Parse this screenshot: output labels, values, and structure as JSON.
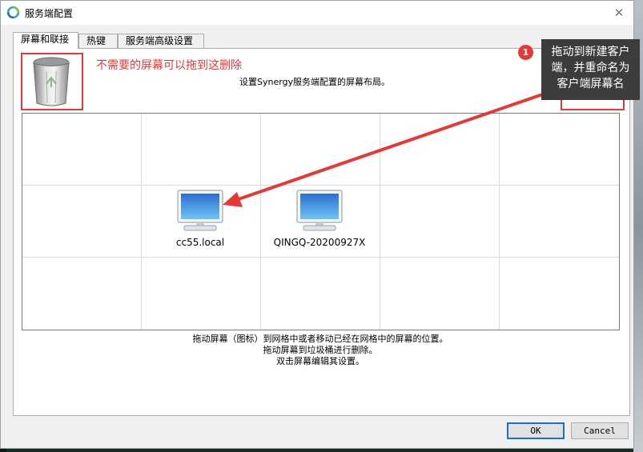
{
  "window": {
    "title": "服务端配置"
  },
  "tabs": [
    {
      "label": "屏幕和联接",
      "active": true
    },
    {
      "label": "热键",
      "active": false
    },
    {
      "label": "服务端高级设置",
      "active": false
    }
  ],
  "panel": {
    "trash_icon": "trash-can-icon",
    "trash_annotation": "不需要的屏幕可以拖到这删除",
    "description": "设置Synergy服务端配置的屏幕布局。",
    "grid": {
      "columns": 5,
      "rows": 3
    },
    "screens": [
      {
        "name": "cc55.local",
        "icon": "monitor-icon",
        "column": 2,
        "row": 2
      },
      {
        "name": "QINGQ-20200927X",
        "icon": "monitor-icon",
        "column": 3,
        "row": 2
      }
    ],
    "instructions": [
      "拖动屏幕（图标）到网格中或者移动已经在网格中的屏幕的位置。",
      "拖动屏幕到垃圾桶进行删除。",
      "双击屏幕编辑其设置。"
    ]
  },
  "buttons": {
    "ok": "OK",
    "cancel": "Cancel"
  },
  "annotation": {
    "badge": "1",
    "note_lines": [
      "拖动到新建客户",
      "端，并重命名为",
      "客户端屏幕名"
    ],
    "accent_color": "#e53935"
  },
  "colors": {
    "accent": "#e53935",
    "default_button_border": "#1a70d0"
  }
}
